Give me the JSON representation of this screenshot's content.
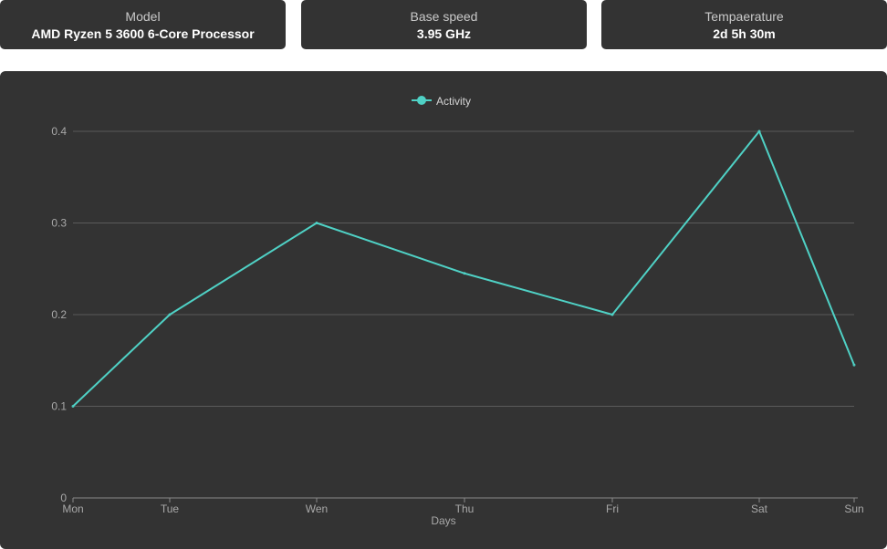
{
  "cards": {
    "model": {
      "label": "Model",
      "value": "AMD Ryzen 5 3600 6-Core Processor"
    },
    "speed": {
      "label": "Base speed",
      "value": "3.95 GHz"
    },
    "temperature": {
      "label": "Tempaerature",
      "value": "2d 5h 30m"
    }
  },
  "chart_data": {
    "type": "line",
    "categories": [
      "Mon",
      "Tue",
      "Wen",
      "Thu",
      "Fri",
      "Sat",
      "Sun"
    ],
    "series": [
      {
        "name": "Activity",
        "values": [
          0.1,
          0.2,
          0.3,
          0.245,
          0.2,
          0.4,
          0.145
        ],
        "color": "#4fd1c5"
      }
    ],
    "y_ticks": [
      "0",
      "0.1",
      "0.2",
      "0.3",
      "0.4"
    ],
    "ylim": [
      0,
      0.4
    ],
    "xlabel": "Days",
    "ylabel": "",
    "title": "",
    "legend": "top-center",
    "grid": "horizontal",
    "colors": {
      "background": "#333333",
      "grid": "#5a5a5a",
      "axis": "#8a8a8a",
      "text": "#a8a8a8"
    }
  }
}
